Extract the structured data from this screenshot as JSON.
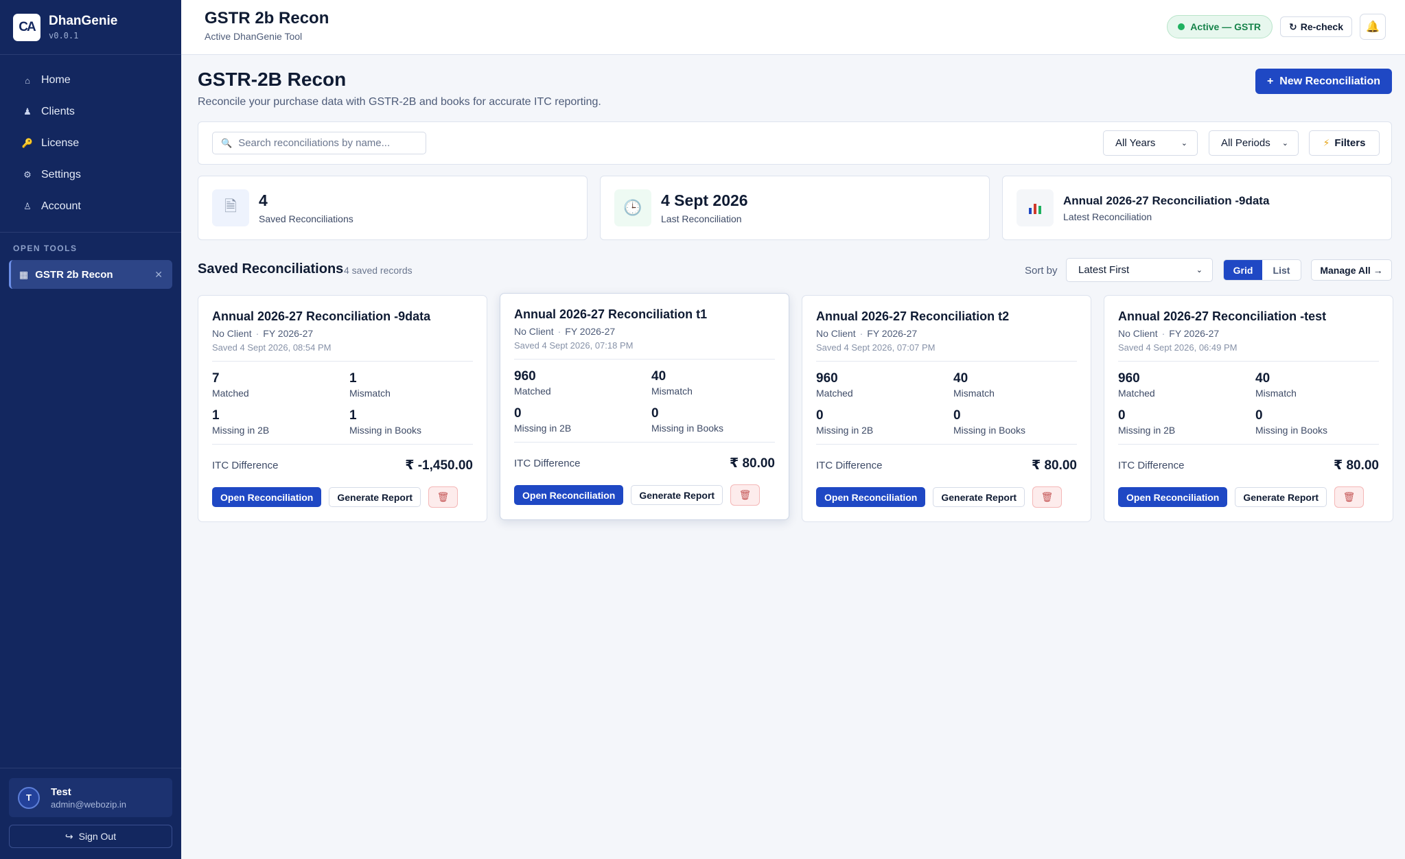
{
  "brand": {
    "logo_text": "CA",
    "name": "DhanGenie",
    "version": "v0.0.1"
  },
  "nav": [
    {
      "label": "Home",
      "icon": "home-icon",
      "glyph": "⌂"
    },
    {
      "label": "Clients",
      "icon": "user-icon",
      "glyph": "♟"
    },
    {
      "label": "License",
      "icon": "key-icon",
      "glyph": "🔑"
    },
    {
      "label": "Settings",
      "icon": "gear-icon",
      "glyph": "⚙"
    },
    {
      "label": "Account",
      "icon": "account-icon",
      "glyph": "♙"
    }
  ],
  "open_tools": {
    "section_label": "OPEN TOOLS",
    "items": [
      {
        "label": "GSTR 2b Recon",
        "icon": "calculator-icon"
      }
    ]
  },
  "user": {
    "initial": "T",
    "name": "Test",
    "email": "admin@webozip.in",
    "signout_label": "Sign Out"
  },
  "header": {
    "title": "GSTR 2b Recon",
    "subtitle": "Active DhanGenie Tool",
    "status": "Active — GSTR",
    "recheck_label": "Re-check",
    "colors": {
      "status_green": "#1fb160"
    }
  },
  "page": {
    "title": "GSTR-2B Recon",
    "subtitle": "Reconcile your purchase data with GSTR-2B and books for accurate ITC reporting.",
    "new_button_label": "New Reconciliation",
    "accent": "#1f48c4"
  },
  "filters": {
    "search_placeholder": "Search reconciliations by name...",
    "years": "All Years",
    "periods": "All Periods",
    "filters_label": "Filters"
  },
  "stats": [
    {
      "value": "4",
      "label": "Saved Reconciliations",
      "icon": "document-icon"
    },
    {
      "value": "4 Sept 2026",
      "label": "Last Reconciliation",
      "icon": "clock-icon"
    },
    {
      "value": "Annual 2026-27 Reconciliation -9data",
      "label": "Latest Reconciliation",
      "icon": "bar-chart-icon"
    }
  ],
  "list": {
    "title": "Saved Reconciliations",
    "count": "4 saved records",
    "sort_label": "Sort by",
    "sort_value": "Latest First",
    "view_grid": "Grid",
    "view_list": "List",
    "active_view": "Grid",
    "manage_label": "Manage All →"
  },
  "labels": {
    "matched": "Matched",
    "mismatch": "Mismatch",
    "missing_2b": "Missing in 2B",
    "missing_books": "Missing in Books",
    "itc_difference": "ITC Difference",
    "open": "Open Reconciliation",
    "generate": "Generate Report"
  },
  "cards": [
    {
      "title": "Annual 2026-27 Reconciliation -9data",
      "client": "No Client",
      "fy": "FY 2026-27",
      "saved": "Saved 4 Sept 2026, 08:54 PM",
      "matched": "7",
      "mismatch": "1",
      "missing_2b": "1",
      "missing_books": "1",
      "itc": "₹ -1,450.00"
    },
    {
      "title": "Annual 2026-27 Reconciliation t1",
      "client": "No Client",
      "fy": "FY 2026-27",
      "saved": "Saved 4 Sept 2026, 07:18 PM",
      "matched": "960",
      "mismatch": "40",
      "missing_2b": "0",
      "missing_books": "0",
      "itc": "₹ 80.00"
    },
    {
      "title": "Annual 2026-27 Reconciliation t2",
      "client": "No Client",
      "fy": "FY 2026-27",
      "saved": "Saved 4 Sept 2026, 07:07 PM",
      "matched": "960",
      "mismatch": "40",
      "missing_2b": "0",
      "missing_books": "0",
      "itc": "₹ 80.00"
    },
    {
      "title": "Annual 2026-27 Reconciliation -test",
      "client": "No Client",
      "fy": "FY 2026-27",
      "saved": "Saved 4 Sept 2026, 06:49 PM",
      "matched": "960",
      "mismatch": "40",
      "missing_2b": "0",
      "missing_books": "0",
      "itc": "₹ 80.00"
    }
  ]
}
